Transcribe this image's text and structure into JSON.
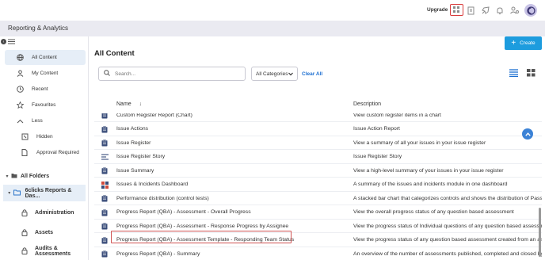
{
  "topbar": {
    "upgrade_label": "Upgrade",
    "icons": [
      "apps-grid-icon",
      "document-icon",
      "rocket-icon",
      "bell-icon",
      "user-settings-icon"
    ],
    "avatar_initials": "6"
  },
  "header": {
    "title": "Reporting & Analytics"
  },
  "sidebar": {
    "items": [
      {
        "label": "All Content",
        "icon": "globe-icon",
        "active": true
      },
      {
        "label": "My Content",
        "icon": "person-icon"
      },
      {
        "label": "Recent",
        "icon": "clock-icon"
      },
      {
        "label": "Favourites",
        "icon": "star-icon"
      },
      {
        "label": "Less",
        "icon": "chevron-up-icon"
      },
      {
        "label": "Hidden",
        "icon": "hidden-icon"
      },
      {
        "label": "Approval Required",
        "icon": "approval-icon"
      }
    ],
    "folders_label": "All Folders",
    "folder_selected": "6clicks Reports & Das...",
    "subfolders": [
      "Administration",
      "Assets",
      "Audits & Assessments"
    ]
  },
  "main": {
    "title": "All Content",
    "create_label": "Create",
    "search_placeholder": "Search...",
    "category_value": "All Categories",
    "clear_all_label": "Clear All",
    "col_name": "Name",
    "col_description": "Description"
  },
  "rows": [
    {
      "name": "Custom Register Report (Chart)",
      "description": "View custom register items in a chart",
      "icon": "clipboard"
    },
    {
      "name": "Issue Actions",
      "description": "Issue Action Report",
      "icon": "clipboard"
    },
    {
      "name": "Issue Register",
      "description": "View a summary of all your issues in your issue register",
      "icon": "clipboard"
    },
    {
      "name": "Issue Register Story",
      "description": "Issue Register Story",
      "icon": "story"
    },
    {
      "name": "Issue Summary",
      "description": "View a high-level summary of your issues in your issue register",
      "icon": "clipboard"
    },
    {
      "name": "Issues & Incidents Dashboard",
      "description": "A summary of the issues and incidents module in one dashboard",
      "icon": "dashboard"
    },
    {
      "name": "Performance distribution (control tests)",
      "description": "A stacked bar chart that categorizes controls and shows the distribution of Pass a",
      "icon": "clipboard"
    },
    {
      "name": "Progress Report (QBA) - Assessment - Overall Progress",
      "description": "View the overall progress status of any question based assessment",
      "icon": "clipboard"
    },
    {
      "name": "Progress Report (QBA) - Assessment - Response Progress by Assignee",
      "description": "View the progress status of Individual questions of any question based assessment",
      "icon": "clipboard"
    },
    {
      "name": "Progress Report (QBA) - Assessment Template - Responding Team Status",
      "description": "View the progress status of any question based assessment created from an assess",
      "icon": "clipboard",
      "highlighted": true
    },
    {
      "name": "Progress Report (QBA) - Summary",
      "description": "An overview of the number of assessments published, completed and closed by m",
      "icon": "clipboard"
    }
  ],
  "colors": {
    "accent": "#1d9cde",
    "highlight": "#d05555",
    "active_bg": "#e6eef7"
  }
}
